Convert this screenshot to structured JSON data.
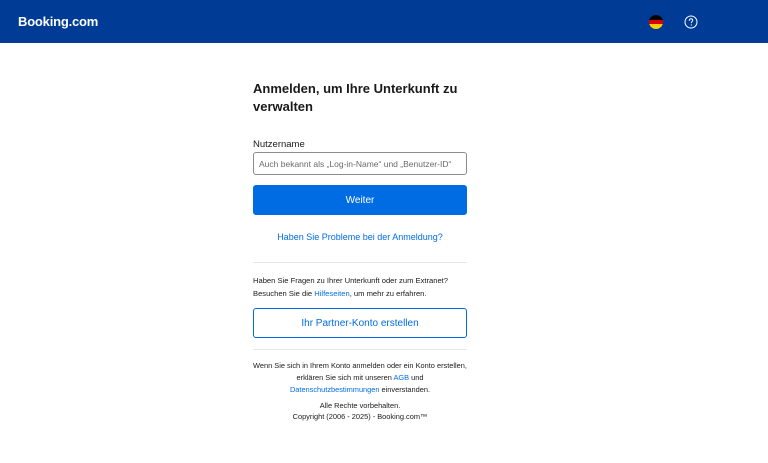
{
  "header": {
    "logo": "Booking.com",
    "flag_colors": [
      "#000000",
      "#dd0000",
      "#ffce00"
    ],
    "language_icon": "german-flag-icon",
    "help_icon": "question-circle-icon"
  },
  "login": {
    "title": "Anmelden, um Ihre Unterkunft zu verwalten",
    "username_label": "Nutzername",
    "username_placeholder": "Auch bekannt als „Log-in-Name“ und „Benutzer-ID“",
    "username_value": "",
    "continue_button": "Weiter",
    "trouble_link": "Haben Sie Probleme bei der Anmeldung?"
  },
  "help": {
    "line1": "Haben Sie Fragen zu Ihrer Unterkunft oder zum Extranet?",
    "prefix": "Besuchen Sie die ",
    "link": "Hilfeseiten",
    "suffix": ", um mehr zu erfahren."
  },
  "partner_button": "Ihr Partner-Konto erstellen",
  "legal": {
    "text1": "Wenn Sie sich in Ihrem Konto anmelden oder ein Konto erstellen, erklären Sie sich mit unseren ",
    "agb_link": "AGB",
    "text2": " und ",
    "privacy_link": "Datenschutzbestimmungen",
    "text3": " einverstanden."
  },
  "footer": {
    "rights": "Alle Rechte vorbehalten.",
    "copyright": "Copyright (2006 - 2025) - Booking.com™"
  },
  "colors": {
    "header_bg": "#003b95",
    "primary": "#006ce4"
  }
}
